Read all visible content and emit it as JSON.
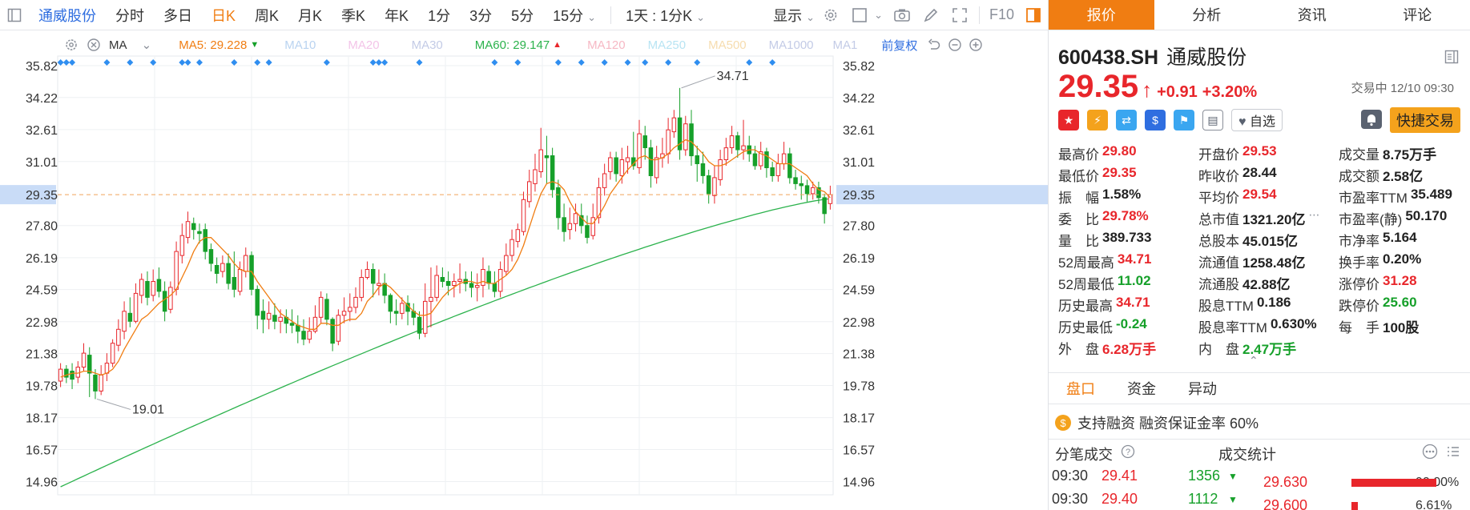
{
  "toolbar": {
    "stock_name": "通威股份",
    "periods": [
      "分时",
      "多日",
      "日K",
      "周K",
      "月K",
      "季K",
      "年K",
      "1分",
      "3分",
      "5分",
      "15分"
    ],
    "active_period": "日K",
    "period_range": "1天 : 1分K",
    "display_label": "显示",
    "f10_label": "F10"
  },
  "ma_legend": {
    "ma_label": "MA",
    "ma5": "MA5: 29.228",
    "ma10": "MA10",
    "ma20": "MA20",
    "ma30": "MA30",
    "ma60": "MA60: 29.147",
    "ma120": "MA120",
    "ma250": "MA250",
    "ma500": "MA500",
    "ma1000": "MA1000",
    "ma_more": "MA1",
    "fq_label": "前复权",
    "colors": {
      "ma5": "#f07d12",
      "ma60": "#2bb24c",
      "faded_ma10": "#b9d3f0",
      "faded_ma20": "#f3c4e8",
      "faded_ma30": "#c3cbe6",
      "faded_ma120": "#f6b8c4",
      "faded_ma250": "#b8e4f3",
      "faded_ma500": "#f6dcae",
      "faded_ma1000": "#c3cbe6"
    }
  },
  "chart_data": {
    "type": "candlestick",
    "y_ticks": [
      35.82,
      34.22,
      32.61,
      31.01,
      29.35,
      27.8,
      26.19,
      24.59,
      22.98,
      21.38,
      19.78,
      18.17,
      16.57,
      14.96
    ],
    "ylim": [
      14.3,
      36.3
    ],
    "current_price": 29.35,
    "annotations": [
      {
        "text": "34.71",
        "value": 34.71,
        "kind": "high"
      },
      {
        "text": "19.01",
        "value": 19.01,
        "kind": "low"
      }
    ],
    "up_color": "#e8262b",
    "down_color": "#16a02a",
    "candles": [
      [
        20.0,
        20.6,
        19.7,
        20.9
      ],
      [
        20.6,
        20.2,
        19.9,
        20.8
      ],
      [
        20.5,
        20.1,
        19.6,
        20.9
      ],
      [
        20.2,
        20.7,
        19.9,
        21.0
      ],
      [
        20.7,
        21.4,
        20.5,
        21.9
      ],
      [
        21.3,
        20.4,
        19.2,
        21.7
      ],
      [
        20.3,
        19.5,
        19.1,
        20.6
      ],
      [
        19.5,
        20.3,
        19.3,
        20.8
      ],
      [
        20.4,
        20.9,
        20.0,
        21.4
      ],
      [
        20.9,
        21.9,
        20.7,
        22.1
      ],
      [
        21.8,
        22.6,
        21.5,
        23.1
      ],
      [
        22.5,
        23.5,
        22.1,
        24.0
      ],
      [
        23.4,
        23.0,
        22.7,
        24.2
      ],
      [
        23.0,
        24.4,
        22.9,
        24.9
      ],
      [
        24.3,
        25.1,
        23.9,
        25.4
      ],
      [
        25.0,
        24.2,
        23.8,
        25.5
      ],
      [
        24.3,
        25.0,
        24.0,
        25.6
      ],
      [
        25.1,
        24.5,
        24.2,
        25.7
      ],
      [
        24.5,
        23.5,
        23.0,
        25.0
      ],
      [
        23.6,
        24.7,
        23.4,
        25.0
      ],
      [
        24.6,
        26.5,
        24.3,
        27.0
      ],
      [
        26.3,
        27.3,
        25.9,
        27.9
      ],
      [
        27.2,
        28.0,
        26.9,
        28.5
      ],
      [
        27.9,
        27.6,
        27.1,
        28.2
      ],
      [
        27.5,
        27.4,
        26.9,
        27.9
      ],
      [
        27.6,
        26.5,
        26.1,
        27.9
      ],
      [
        26.6,
        25.9,
        25.5,
        26.9
      ],
      [
        25.8,
        25.4,
        24.9,
        26.2
      ],
      [
        25.5,
        25.9,
        25.2,
        26.3
      ],
      [
        25.9,
        24.9,
        24.6,
        26.4
      ],
      [
        25.2,
        24.6,
        24.2,
        26.5
      ],
      [
        24.5,
        25.6,
        24.3,
        26.0
      ],
      [
        25.5,
        26.3,
        25.2,
        26.7
      ],
      [
        26.3,
        24.6,
        24.3,
        26.5
      ],
      [
        24.6,
        23.3,
        22.6,
        24.8
      ],
      [
        23.5,
        23.1,
        22.4,
        24.1
      ],
      [
        23.1,
        23.4,
        22.6,
        24.0
      ],
      [
        23.3,
        23.0,
        22.6,
        23.9
      ],
      [
        23.0,
        23.2,
        22.4,
        23.6
      ],
      [
        23.2,
        22.9,
        22.4,
        23.6
      ],
      [
        22.9,
        22.8,
        22.4,
        23.6
      ],
      [
        22.8,
        22.5,
        21.9,
        23.3
      ],
      [
        22.5,
        22.1,
        21.8,
        23.1
      ],
      [
        22.1,
        22.5,
        21.9,
        23.2
      ],
      [
        22.5,
        23.2,
        22.4,
        23.8
      ],
      [
        23.2,
        24.2,
        22.9,
        24.5
      ],
      [
        24.1,
        23.1,
        22.8,
        24.4
      ],
      [
        23.1,
        21.9,
        21.5,
        23.2
      ],
      [
        22.0,
        23.3,
        21.8,
        23.6
      ],
      [
        23.3,
        23.5,
        22.9,
        24.2
      ],
      [
        23.5,
        23.7,
        23.0,
        24.4
      ],
      [
        23.7,
        24.2,
        23.4,
        24.7
      ],
      [
        24.2,
        25.2,
        24.0,
        25.6
      ],
      [
        25.2,
        25.6,
        25.1,
        26.0
      ],
      [
        25.6,
        24.9,
        24.2,
        25.9
      ],
      [
        24.8,
        24.9,
        24.3,
        25.6
      ],
      [
        24.9,
        24.3,
        23.9,
        25.4
      ],
      [
        24.3,
        23.5,
        22.9,
        24.4
      ],
      [
        23.5,
        23.4,
        22.8,
        24.1
      ],
      [
        23.4,
        23.9,
        23.1,
        24.2
      ],
      [
        23.9,
        23.5,
        22.8,
        24.3
      ],
      [
        23.5,
        23.2,
        22.8,
        23.9
      ],
      [
        23.2,
        22.4,
        22.1,
        23.5
      ],
      [
        22.4,
        24.0,
        22.2,
        24.9
      ],
      [
        24.0,
        24.2,
        22.7,
        25.7
      ],
      [
        24.2,
        25.3,
        24.0,
        25.8
      ],
      [
        25.2,
        25.0,
        24.7,
        25.7
      ],
      [
        25.0,
        24.8,
        24.3,
        25.5
      ],
      [
        24.8,
        25.0,
        24.2,
        25.4
      ],
      [
        25.0,
        25.1,
        24.4,
        25.9
      ],
      [
        25.1,
        24.9,
        24.5,
        25.5
      ],
      [
        24.9,
        24.7,
        24.2,
        25.5
      ],
      [
        24.7,
        24.8,
        24.0,
        25.4
      ],
      [
        24.8,
        25.6,
        24.2,
        26.2
      ],
      [
        25.5,
        24.9,
        24.6,
        25.8
      ],
      [
        24.9,
        24.5,
        24.2,
        25.5
      ],
      [
        24.5,
        25.6,
        24.2,
        26.0
      ],
      [
        25.5,
        26.3,
        25.3,
        26.9
      ],
      [
        26.3,
        27.1,
        26.0,
        27.6
      ],
      [
        27.0,
        27.6,
        26.7,
        27.9
      ],
      [
        27.5,
        29.1,
        27.3,
        29.5
      ],
      [
        29.0,
        30.0,
        28.7,
        30.6
      ],
      [
        29.9,
        30.6,
        29.5,
        31.4
      ],
      [
        30.5,
        31.6,
        30.2,
        32.7
      ],
      [
        31.3,
        31.2,
        29.9,
        32.3
      ],
      [
        31.3,
        29.6,
        29.2,
        31.7
      ],
      [
        29.7,
        28.2,
        27.6,
        30.1
      ],
      [
        28.2,
        27.5,
        27.0,
        28.9
      ],
      [
        27.6,
        27.9,
        27.1,
        28.7
      ],
      [
        27.9,
        28.4,
        27.5,
        28.9
      ],
      [
        28.3,
        27.8,
        27.4,
        28.9
      ],
      [
        27.8,
        27.2,
        26.9,
        28.3
      ],
      [
        27.3,
        28.2,
        27.1,
        28.9
      ],
      [
        28.2,
        29.7,
        27.9,
        30.2
      ],
      [
        29.7,
        30.4,
        29.3,
        30.9
      ],
      [
        30.5,
        31.2,
        30.1,
        31.5
      ],
      [
        31.2,
        30.4,
        30.0,
        31.5
      ],
      [
        30.3,
        31.1,
        29.9,
        31.7
      ],
      [
        31.0,
        31.2,
        30.4,
        31.8
      ],
      [
        31.2,
        30.8,
        30.6,
        32.5
      ],
      [
        30.7,
        32.4,
        30.4,
        33.1
      ],
      [
        32.3,
        31.7,
        31.1,
        32.8
      ],
      [
        31.7,
        30.3,
        29.7,
        32.1
      ],
      [
        30.2,
        31.2,
        29.9,
        31.8
      ],
      [
        31.2,
        31.4,
        30.7,
        32.2
      ],
      [
        31.4,
        32.6,
        30.9,
        33.2
      ],
      [
        32.5,
        33.2,
        32.2,
        33.6
      ],
      [
        33.2,
        31.6,
        31.1,
        34.7
      ],
      [
        31.6,
        32.9,
        31.3,
        33.3
      ],
      [
        32.9,
        31.3,
        30.8,
        33.6
      ],
      [
        31.3,
        30.9,
        30.0,
        31.8
      ],
      [
        30.9,
        30.3,
        29.9,
        31.5
      ],
      [
        30.3,
        29.4,
        28.9,
        30.6
      ],
      [
        29.3,
        30.2,
        28.9,
        30.8
      ],
      [
        30.1,
        31.1,
        29.8,
        31.6
      ],
      [
        31.1,
        31.7,
        30.8,
        32.2
      ],
      [
        31.7,
        32.3,
        31.4,
        32.8
      ],
      [
        32.3,
        31.6,
        31.2,
        32.5
      ],
      [
        31.6,
        31.8,
        31.1,
        33.1
      ],
      [
        31.8,
        31.4,
        31.0,
        32.3
      ],
      [
        31.4,
        30.8,
        30.6,
        31.8
      ],
      [
        30.8,
        31.5,
        30.6,
        32.0
      ],
      [
        31.5,
        30.7,
        30.2,
        31.7
      ],
      [
        30.7,
        30.3,
        30.0,
        31.0
      ],
      [
        30.3,
        30.9,
        30.0,
        31.4
      ],
      [
        30.9,
        31.4,
        30.6,
        32.0
      ],
      [
        31.4,
        30.2,
        29.9,
        31.7
      ],
      [
        30.2,
        29.9,
        29.6,
        30.6
      ],
      [
        29.9,
        29.8,
        29.1,
        30.3
      ],
      [
        29.8,
        29.4,
        29.0,
        30.1
      ],
      [
        29.4,
        29.7,
        29.1,
        30.0
      ],
      [
        29.7,
        29.2,
        28.9,
        30.0
      ],
      [
        29.2,
        28.4,
        27.9,
        29.4
      ],
      [
        28.9,
        29.35,
        28.6,
        29.8
      ]
    ],
    "ma5": [
      20.2,
      20.3,
      20.4,
      20.4,
      20.5,
      20.5,
      20.4,
      20.3,
      20.4,
      20.6,
      21.0,
      21.6,
      22.1,
      22.6,
      23.1,
      23.3,
      23.6,
      23.9,
      24.1,
      24.3,
      24.6,
      25.2,
      25.8,
      26.5,
      27.0,
      27.2,
      27.2,
      26.9,
      26.6,
      26.3,
      25.9,
      25.6,
      25.5,
      25.5,
      25.0,
      24.6,
      24.2,
      23.8,
      23.4,
      23.2,
      23.0,
      22.8,
      22.7,
      22.6,
      22.6,
      22.9,
      22.9,
      22.8,
      22.8,
      23.0,
      23.1,
      23.1,
      23.4,
      24.0,
      24.3,
      24.7,
      24.9,
      24.7,
      24.4,
      24.1,
      23.8,
      23.5,
      23.3,
      23.3,
      23.4,
      23.8,
      24.2,
      24.5,
      24.7,
      24.9,
      25.0,
      25.0,
      24.9,
      25.0,
      24.9,
      24.9,
      25.1,
      25.3,
      25.6,
      26.1,
      26.8,
      27.7,
      28.6,
      29.4,
      29.9,
      30.0,
      29.9,
      29.6,
      29.0,
      28.5,
      28.2,
      27.9,
      27.9,
      28.3,
      28.8,
      29.4,
      29.8,
      30.2,
      30.6,
      30.9,
      31.2,
      31.3,
      31.1,
      31.1,
      31.2,
      31.4,
      31.7,
      31.9,
      32.1,
      32.0,
      31.7,
      31.4,
      31.0,
      30.8,
      30.8,
      30.9,
      31.1,
      31.3,
      31.5,
      31.6,
      31.6,
      31.4,
      31.3,
      31.1,
      30.9,
      30.9,
      30.9,
      30.7,
      30.5,
      30.3,
      29.9,
      29.6,
      29.5,
      29.2,
      29.23
    ]
  },
  "right_panel": {
    "tabs": [
      "报价",
      "分析",
      "资讯",
      "评论"
    ],
    "active_tab": "报价",
    "code": "600438.SH",
    "name": "通威股份",
    "price": "29.35",
    "arrow": "↑",
    "change": "+0.91",
    "change_pct": "+3.20%",
    "trade_status": "交易中 12/10 09:30",
    "fav_label": "自选",
    "quick_trade_label": "快捷交易",
    "stats_rows": [
      [
        {
          "label": "最高价",
          "value": "29.80",
          "tone": "red"
        },
        {
          "label": "开盘价",
          "value": "29.53",
          "tone": "red"
        },
        {
          "label": "成交量",
          "value": "8.75万手",
          "tone": "dark"
        }
      ],
      [
        {
          "label": "最低价",
          "value": "29.35",
          "tone": "red"
        },
        {
          "label": "昨收价",
          "value": "28.44",
          "tone": "dark"
        },
        {
          "label": "成交额",
          "value": "2.58亿",
          "tone": "dark"
        }
      ],
      [
        {
          "label": "振　幅",
          "value": "1.58%",
          "tone": "dark"
        },
        {
          "label": "平均价",
          "value": "29.54",
          "tone": "red"
        },
        {
          "label": "市盈率TTM",
          "value": "35.489",
          "tone": "dark"
        }
      ],
      [
        {
          "label": "委　比",
          "value": "29.78%",
          "tone": "red"
        },
        {
          "label": "总市值",
          "value": "1321.20亿",
          "tone": "dark"
        },
        {
          "label": "市盈率(静)",
          "value": "50.170",
          "tone": "dark"
        }
      ],
      [
        {
          "label": "量　比",
          "value": "389.733",
          "tone": "dark"
        },
        {
          "label": "总股本",
          "value": "45.015亿",
          "tone": "dark"
        },
        {
          "label": "市净率",
          "value": "5.164",
          "tone": "dark"
        }
      ],
      [
        {
          "label": "52周最高",
          "value": "34.71",
          "tone": "red"
        },
        {
          "label": "流通值",
          "value": "1258.48亿",
          "tone": "dark"
        },
        {
          "label": "换手率",
          "value": "0.20%",
          "tone": "dark"
        }
      ],
      [
        {
          "label": "52周最低",
          "value": "11.02",
          "tone": "green"
        },
        {
          "label": "流通股",
          "value": "42.88亿",
          "tone": "dark"
        },
        {
          "label": "涨停价",
          "value": "31.28",
          "tone": "red"
        }
      ],
      [
        {
          "label": "历史最高",
          "value": "34.71",
          "tone": "red"
        },
        {
          "label": "股息TTM",
          "value": "0.186",
          "tone": "dark"
        },
        {
          "label": "跌停价",
          "value": "25.60",
          "tone": "green"
        }
      ],
      [
        {
          "label": "历史最低",
          "value": "-0.24",
          "tone": "green"
        },
        {
          "label": "股息率TTM",
          "value": "0.630%",
          "tone": "dark"
        },
        {
          "label": "每　手",
          "value": "100股",
          "tone": "dark"
        }
      ],
      [
        {
          "label": "外　盘",
          "value": "6.28万手",
          "tone": "red"
        },
        {
          "label": "内　盘",
          "value": "2.47万手",
          "tone": "green"
        },
        {
          "label": "",
          "value": "",
          "tone": "dark"
        }
      ]
    ],
    "section_tabs": [
      "盘口",
      "资金",
      "异动"
    ],
    "margin_text": "支持融资 融资保证金率 60%",
    "trades_title": "分笔成交",
    "volume_stats_title": "成交统计",
    "trades": [
      {
        "time": "09:30",
        "price": "29.41",
        "vol": "1356"
      },
      {
        "time": "09:30",
        "price": "29.40",
        "vol": "1112"
      }
    ],
    "volume_stats": [
      {
        "price": "29.630",
        "pct": "90.00%",
        "fill": 0.9
      },
      {
        "price": "29.600",
        "pct": "6.61%",
        "fill": 0.07
      }
    ]
  }
}
